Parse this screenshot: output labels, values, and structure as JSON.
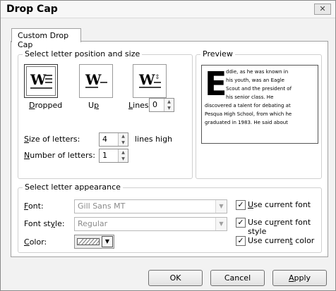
{
  "dialog": {
    "title": "Drop Cap",
    "close_glyph": "✕"
  },
  "tabs": [
    {
      "label": "Custom Drop Cap"
    }
  ],
  "position_group": {
    "title": "Select letter position and size",
    "options": [
      {
        "label": "Dropped",
        "mnemonic": "D",
        "rest": "ropped",
        "selected": true
      },
      {
        "label": "Up",
        "pre": "U",
        "mnemonic": "p",
        "selected": false
      },
      {
        "label": "Lines",
        "mnemonic": "L",
        "rest": "ines",
        "selected": false
      }
    ],
    "lines_value": "0",
    "size_label_m": "S",
    "size_label_rest": "ize of letters:",
    "size_value": "4",
    "size_unit": "lines high",
    "number_label_m": "N",
    "number_label_rest": "umber of letters:",
    "number_value": "1"
  },
  "preview": {
    "title": "Preview",
    "drop_letter": "E",
    "lines": [
      "ddie, as he was known in",
      "his youth, was an Eagle",
      "Scout and the president of",
      "his senior class. He",
      "discovered a talent for debating at",
      "Pesqua High School, from which he",
      "graduated in 1983. He said about"
    ]
  },
  "appearance_group": {
    "title": "Select letter appearance",
    "font_label_m": "F",
    "font_label_rest": "ont:",
    "font_value": "Gill Sans MT",
    "style_label_pre": "Font st",
    "style_label_m": "y",
    "style_label_rest": "le:",
    "style_value": "Regular",
    "color_label_m": "C",
    "color_label_rest": "olor:",
    "checks": [
      {
        "pre": "",
        "m": "U",
        "rest": "se current font",
        "checked": true
      },
      {
        "pre": "Use cu",
        "m": "r",
        "rest": "rent font style",
        "checked": true
      },
      {
        "pre": "Use curren",
        "m": "t",
        "rest": " color",
        "checked": true
      }
    ]
  },
  "buttons": {
    "ok": "OK",
    "cancel": "Cancel",
    "apply_m": "A",
    "apply_rest": "pply"
  },
  "icons": {
    "spin_up": "▲",
    "spin_down": "▼",
    "dropdown": "▼",
    "check": "✓"
  }
}
